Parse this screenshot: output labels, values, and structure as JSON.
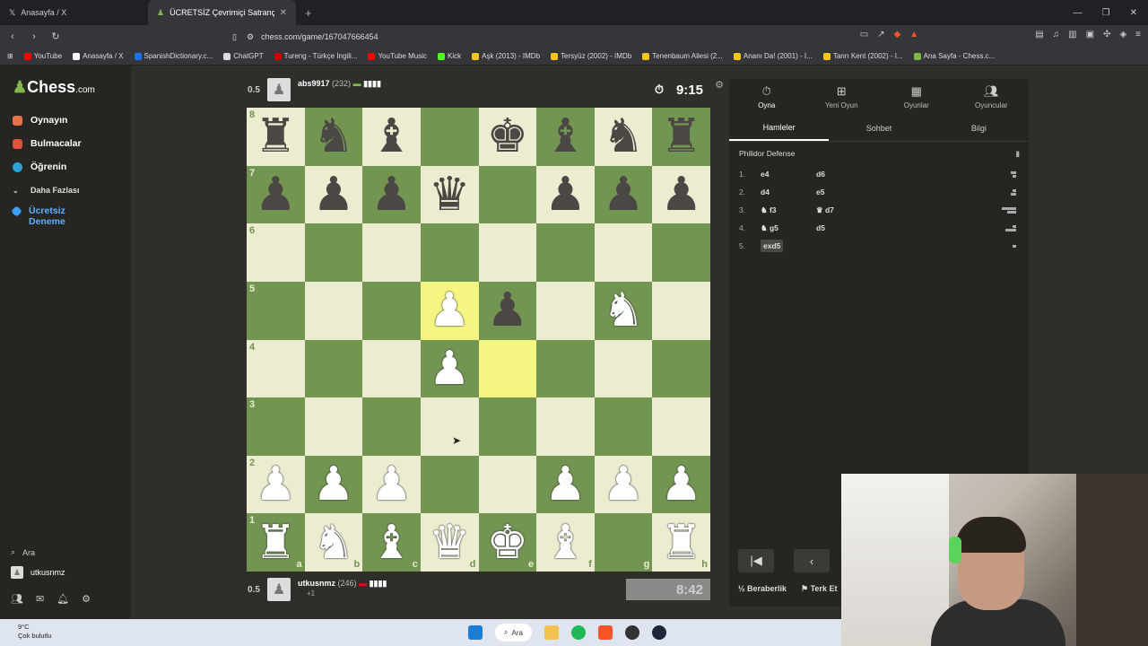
{
  "browser": {
    "tabs": [
      {
        "label": "Anasayfa / X"
      },
      {
        "label": "ÜCRETSİZ Çevrimiçi Satranç Oyn..."
      }
    ],
    "url": "chess.com/game/167047666454",
    "bookmarks": [
      {
        "label": "YouTube",
        "color": "#ff0000"
      },
      {
        "label": "Anasayfa / X",
        "color": "#ffffff"
      },
      {
        "label": "SpanishDictionary.c...",
        "color": "#1a73e8"
      },
      {
        "label": "ChatGPT",
        "color": "#dddddd"
      },
      {
        "label": "Tureng - Türkçe İngili...",
        "color": "#d00000"
      },
      {
        "label": "YouTube Music",
        "color": "#ff0000"
      },
      {
        "label": "Kick",
        "color": "#53fc18"
      },
      {
        "label": "Aşk (2013) - IMDb",
        "color": "#f5c518"
      },
      {
        "label": "Tersyüz (2002) - IMDb",
        "color": "#f5c518"
      },
      {
        "label": "Tenenbaum Ailesi (2...",
        "color": "#f5c518"
      },
      {
        "label": "Ananı Da! (2001) - I...",
        "color": "#f5c518"
      },
      {
        "label": "Tanrı Kent (2002) - I...",
        "color": "#f5c518"
      },
      {
        "label": "Ana Sayfa - Chess.c...",
        "color": "#81b64c"
      }
    ]
  },
  "sidebar": {
    "logo": "Chess",
    "logo_suffix": ".com",
    "items": [
      {
        "label": "Oynayın",
        "color": "#e8734a"
      },
      {
        "label": "Bulmacalar",
        "color": "#e0533a"
      },
      {
        "label": "Öğrenin",
        "color": "#2aa4d6"
      },
      {
        "label": "Daha Fazlası",
        "color": ""
      },
      {
        "label": "Ücretsiz Deneme",
        "color": "#3aa0ff"
      }
    ],
    "search_label": "Ara",
    "username": "utkusnmz"
  },
  "top_player": {
    "score": "0.5",
    "name": "abs9917",
    "rating": "(232)",
    "clock": "9:15"
  },
  "bottom_player": {
    "score": "0.5",
    "name": "utkusnmz",
    "rating": "(246)",
    "extra": "+1",
    "clock": "8:42"
  },
  "board": {
    "ranks": [
      "8",
      "7",
      "6",
      "5",
      "4",
      "3",
      "2",
      "1"
    ],
    "files": [
      "a",
      "b",
      "c",
      "d",
      "e",
      "f",
      "g",
      "h"
    ],
    "position": [
      [
        "bR",
        "bN",
        "bB",
        "",
        "bK",
        "bB",
        "bN",
        "bR"
      ],
      [
        "bP",
        "bP",
        "bP",
        "bQ",
        "",
        "bP",
        "bP",
        "bP"
      ],
      [
        "",
        "",
        "",
        "",
        "",
        "",
        "",
        ""
      ],
      [
        "",
        "",
        "",
        "wP",
        "bP",
        "",
        "wN",
        ""
      ],
      [
        "",
        "",
        "",
        "wP",
        "",
        "",
        "",
        ""
      ],
      [
        "",
        "",
        "",
        "",
        "",
        "",
        "",
        ""
      ],
      [
        "wP",
        "wP",
        "wP",
        "",
        "",
        "wP",
        "wP",
        "wP"
      ],
      [
        "wR",
        "wN",
        "wB",
        "wQ",
        "wK",
        "wB",
        "",
        "wR"
      ]
    ],
    "highlights": [
      "d5",
      "e4"
    ]
  },
  "panel": {
    "tabs": [
      {
        "label": "Oyna",
        "icon": "stopwatch-icon"
      },
      {
        "label": "Yeni Oyun",
        "icon": "plus-icon"
      },
      {
        "label": "Oyunlar",
        "icon": "board-icon"
      },
      {
        "label": "Oyuncular",
        "icon": "players-icon"
      }
    ],
    "subtabs": [
      "Hamleler",
      "Sohbet",
      "Bilgi"
    ],
    "opening": "Philidor Defense",
    "moves": [
      {
        "num": "1.",
        "white": "e4",
        "black": "d6"
      },
      {
        "num": "2.",
        "white": "d4",
        "black": "e5"
      },
      {
        "num": "3.",
        "white": "♞ f3",
        "black": "♛ d7"
      },
      {
        "num": "4.",
        "white": "♞ g5",
        "black": "d5"
      },
      {
        "num": "5.",
        "white": "exd5",
        "black": ""
      }
    ],
    "actions": [
      "½ Beraberlik",
      "⚑ Terk Et"
    ]
  },
  "taskbar": {
    "temp": "9°C",
    "weather": "Çok bulutlu",
    "search": "Ara"
  }
}
